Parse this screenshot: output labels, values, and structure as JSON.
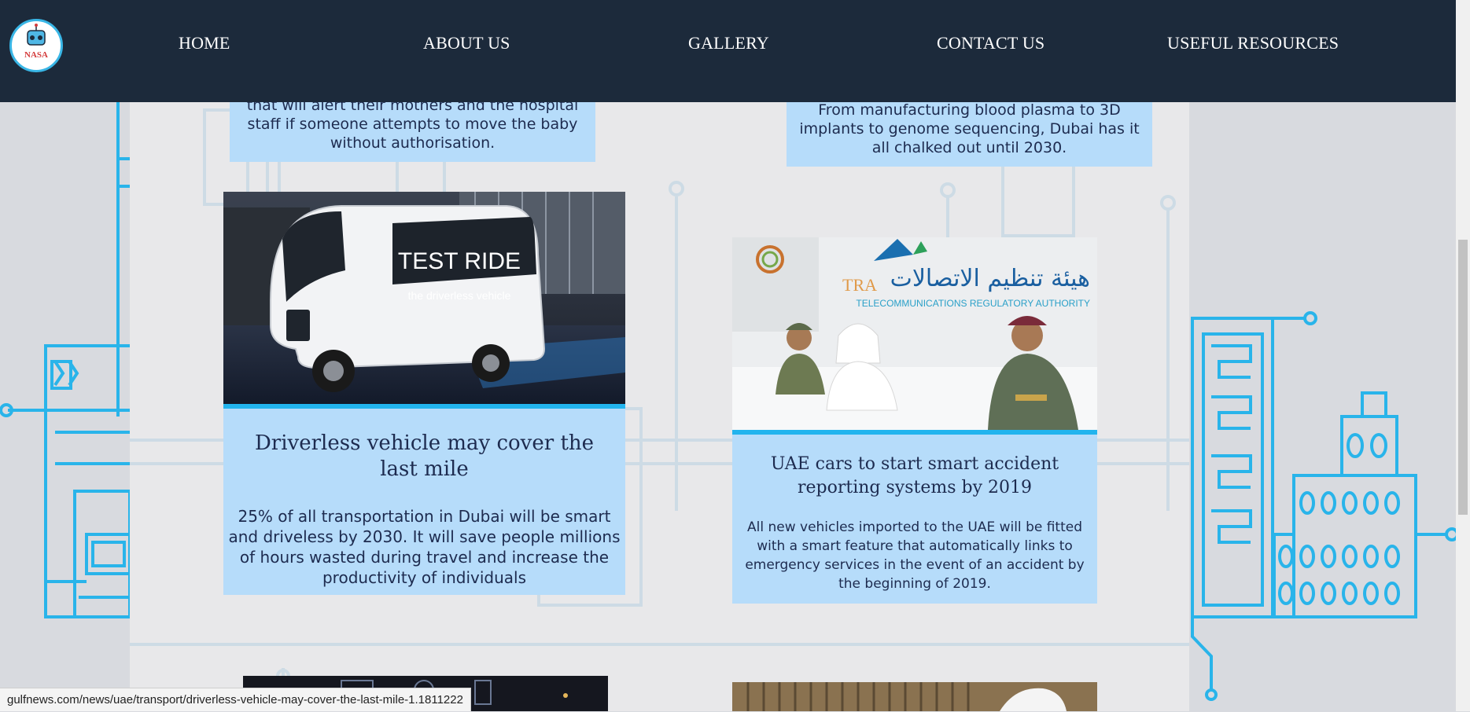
{
  "logo": {
    "text": "NASA"
  },
  "nav": [
    {
      "label": "HOME"
    },
    {
      "label": "ABOUT US"
    },
    {
      "label": "GALLERY"
    },
    {
      "label": "CONTACT US"
    },
    {
      "label": "USEFUL RESOURCES"
    }
  ],
  "cards": {
    "top_left": {
      "text": "that will alert their mothers and the hospital staff if someone attempts to move the baby without authorisation."
    },
    "top_right": {
      "text": "From manufacturing blood plasma to 3D implants to genome sequencing, Dubai has it all chalked out until 2030."
    },
    "driverless": {
      "image_caption": "TEST RIDE",
      "image_subcaption": "the driverless vehicle",
      "title": "Driverless vehicle may cover the last mile",
      "body": "25% of all transportation in Dubai will be smart and driveless by 2030. It will save people millions of hours wasted during travel and increase the productivity of individuals"
    },
    "uae_cars": {
      "image_logo_arabic": "هيئة تنظيم الاتصالات",
      "image_logo_english": "TELECOMMUNICATIONS REGULATORY AUTHORITY",
      "image_logo_tra": "TRA",
      "title": "UAE cars to start smart accident reporting systems by 2019",
      "body": "All new vehicles imported to the UAE will be fitted with a smart feature that automatically links to emergency services in the event of an accident by the beginning of 2019."
    }
  },
  "status_bar": {
    "url": "gulfnews.com/news/uae/transport/driverless-vehicle-may-cover-the-last-mile-1.1811222"
  },
  "colors": {
    "navbar": "#1c2a3b",
    "card": "#b6dcfa",
    "accent": "#22b4ee",
    "text": "#1d2b4f"
  }
}
